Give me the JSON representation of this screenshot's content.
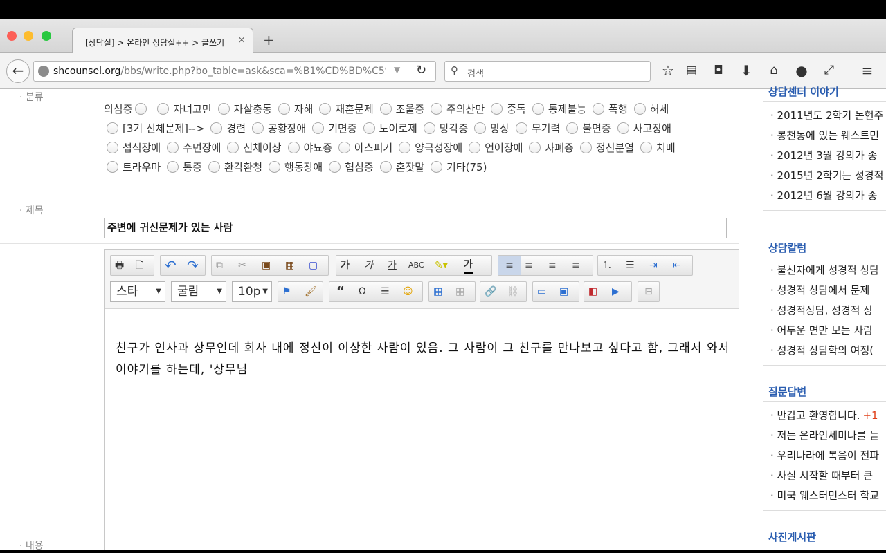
{
  "browser": {
    "tab_title": "[상담실] > 온라인 상담실++ > 글쓰기",
    "tab_close": "×",
    "new_tab": "+",
    "url_domain": "shcounsel.org",
    "url_path": "/bbs/write.php?bo_table=ask&sca=%B1%CD%BD%C5%",
    "search_placeholder": "검색"
  },
  "form": {
    "category_label": "분류",
    "subject_label": "제목",
    "content_label": "내용",
    "categories": [
      "의심증",
      "자녀고민",
      "자살충동",
      "자해",
      "재혼문제",
      "조울증",
      "주의산만",
      "중독",
      "통제불능",
      "폭행",
      "허세",
      "[3기 신체문제]-->",
      "경련",
      "공황장애",
      "기면증",
      "노이로제",
      "망각증",
      "망상",
      "무기력",
      "불면증",
      "사고장애",
      "섭식장애",
      "수면장애",
      "신체이상",
      "야뇨증",
      "아스퍼거",
      "양극성장애",
      "언어장애",
      "자폐증",
      "정신분열",
      "치매",
      "트라우마",
      "통증",
      "환각환청",
      "행동장애",
      "협심증",
      "혼잣말",
      "기타(75)"
    ],
    "subject_value": "주변에 귀신문제가 있는 사람",
    "body_text": "친구가 인사과 상무인데 회사 내에 정신이 이상한 사람이 있음. 그 사람이 그 친구를 만나보고 싶다고 함, 그래서 와서 이야기를 하는데, '상무님 "
  },
  "editor_toolbar": {
    "style_select": "스타",
    "font_select": "굴림",
    "size_select": "10p",
    "buttons_row1": [
      "print",
      "new",
      "undo",
      "redo",
      "copy",
      "cut",
      "paste",
      "paste-text",
      "select-all",
      "bold",
      "italic",
      "underline",
      "strike",
      "highlight",
      "font-color",
      "align-left",
      "align-center",
      "align-right",
      "justify",
      "ordered-list",
      "unordered-list",
      "indent",
      "outdent"
    ],
    "bold_glyph": "가",
    "italic_glyph": "가",
    "underline_glyph": "가",
    "strike_glyph": "ABC",
    "fontcolor_glyph": "가",
    "quote_glyph": "“",
    "omega_glyph": "Ω"
  },
  "sidebar": {
    "sections": [
      {
        "title": "상담센터 이야기",
        "items": [
          "2011년도 2학기 논현주",
          "봉천동에 있는 웨스트민",
          "2012년 3월 강의가 종",
          "2015년 2학기는 성경적",
          "2012년 6월 강의가 종"
        ]
      },
      {
        "title": "상담칼럼",
        "items": [
          "불신자에게 성경적 상담",
          "성경적 상담에서 문제",
          "성경적상담, 성경적 상",
          "어두운 면만 보는 사람",
          "성경적 상담학의 여정("
        ]
      },
      {
        "title": "질문답변",
        "items": [
          "반갑고 환영합니다.",
          "저는 온라인세미나를 듣",
          "우리나라에 복음이 전파",
          "사실 시작할 때부터 큰",
          "미국 웨스터민스터 학교"
        ],
        "first_item_count": "+1"
      },
      {
        "title": "사진게시판",
        "items": []
      }
    ]
  },
  "colors": {
    "link_blue": "#2a5db0",
    "count_red": "#e0401a"
  }
}
